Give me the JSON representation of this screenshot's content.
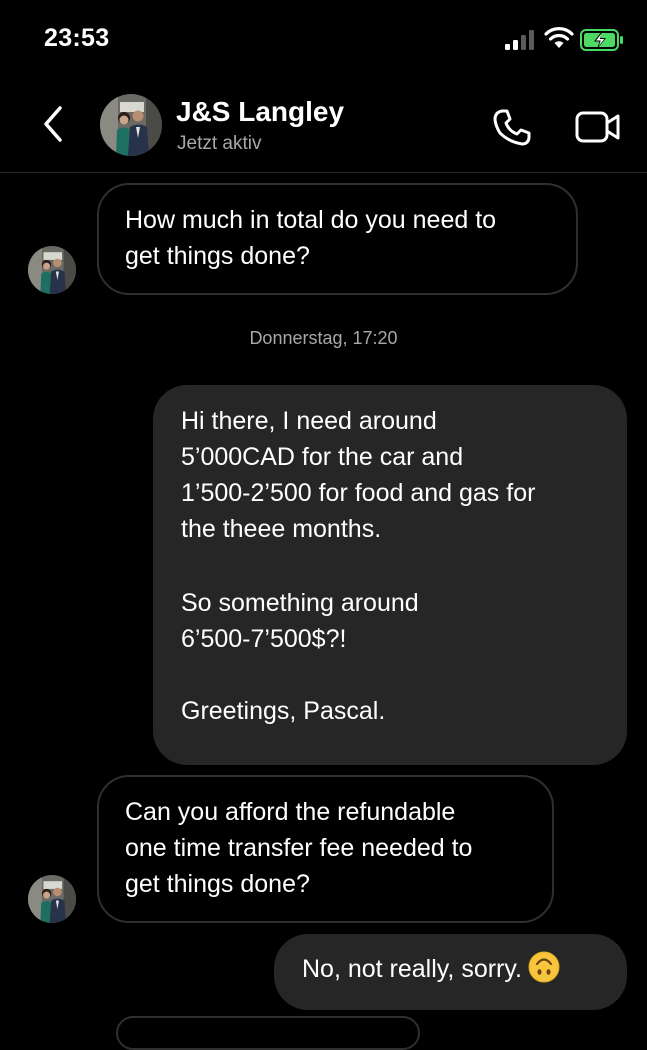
{
  "status_bar": {
    "time": "23:53",
    "icons": [
      "cellular-signal-icon",
      "wifi-icon",
      "battery-charging-icon"
    ]
  },
  "header": {
    "back_icon": "chevron-left-icon",
    "contact_name": "J&S Langley",
    "contact_status": "Jetzt aktiv",
    "actions": [
      "phone-call-icon",
      "video-call-icon"
    ]
  },
  "conversation": {
    "messages": [
      {
        "direction": "incoming",
        "text": "How much in total do you need to\nget things done?"
      },
      {
        "type": "timestamp",
        "text": "Donnerstag, 17:20"
      },
      {
        "direction": "outgoing",
        "paragraphs": [
          "Hi there, I need around\n5’000CAD for the car and\n1’500-2’500 for food and gas for\nthe theee months.",
          "So something around\n6’500-7’500$?!",
          "Greetings, Pascal."
        ]
      },
      {
        "direction": "incoming",
        "text": "Can you afford the refundable\none time transfer fee needed to\nget things done?"
      },
      {
        "direction": "outgoing",
        "text": "No, not really, sorry.",
        "emoji": "upside-down-face-emoji-icon"
      }
    ]
  },
  "colors": {
    "background": "#000000",
    "outgoing_bubble": "#262626",
    "incoming_border": "#2f2f2f",
    "secondary_text": "#a8a8a8",
    "battery_green": "#4cd964"
  }
}
